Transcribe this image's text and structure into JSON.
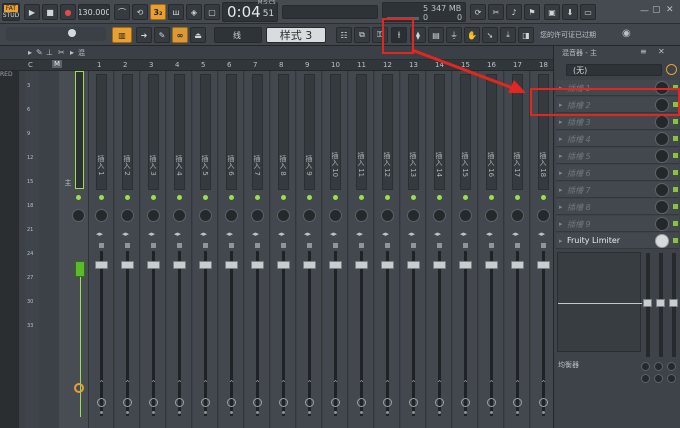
{
  "toolbar": {
    "fl_badge": "FAT",
    "fl_sub": "STUD",
    "tempo": "130.000",
    "time_main": "0:04",
    "time_frac": "51",
    "time_label": "M:S:CS",
    "counter_top": "5",
    "memory": "347 MB",
    "counter_bottom": "0",
    "cpu_top": "0",
    "beat_label": "3₂",
    "pattern_dropdown": "线",
    "pattern_name": "样式 3",
    "hint_text": "您的许可证已过期"
  },
  "mixer": {
    "header_label": "混",
    "ruler": {
      "c_label": "C",
      "m_label": "M"
    },
    "left_label": "RED",
    "master_name": "主",
    "inserts": [
      {
        "num": "1",
        "name": "插入 1"
      },
      {
        "num": "2",
        "name": "插入 2"
      },
      {
        "num": "3",
        "name": "插入 3"
      },
      {
        "num": "4",
        "name": "插入 4"
      },
      {
        "num": "5",
        "name": "插入 5"
      },
      {
        "num": "6",
        "name": "插入 6"
      },
      {
        "num": "7",
        "name": "插入 7"
      },
      {
        "num": "8",
        "name": "插入 8"
      },
      {
        "num": "9",
        "name": "插入 9"
      },
      {
        "num": "10",
        "name": "插入 10"
      },
      {
        "num": "11",
        "name": "插入 11"
      },
      {
        "num": "12",
        "name": "插入 12"
      },
      {
        "num": "13",
        "name": "插入 13"
      },
      {
        "num": "14",
        "name": "插入 14"
      },
      {
        "num": "15",
        "name": "插入 15"
      },
      {
        "num": "16",
        "name": "插入 16"
      },
      {
        "num": "17",
        "name": "插入 17"
      },
      {
        "num": "18",
        "name": "插入 18"
      }
    ],
    "scale": [
      "3",
      "6",
      "9",
      "12",
      "15",
      "18",
      "21",
      "24",
      "27",
      "30",
      "33"
    ]
  },
  "fx_panel": {
    "title": "混音器 - 主",
    "input_dropdown": "(无)",
    "slots": [
      {
        "name": "插槽 1"
      },
      {
        "name": "插槽 2"
      },
      {
        "name": "插槽 3"
      },
      {
        "name": "插槽 4"
      },
      {
        "name": "插槽 5"
      },
      {
        "name": "插槽 6"
      },
      {
        "name": "插槽 7"
      },
      {
        "name": "插槽 8"
      },
      {
        "name": "插槽 9"
      },
      {
        "name": "Fruity Limiter"
      }
    ],
    "eq_label": "均衡器"
  },
  "colors": {
    "accent_red": "#e1271f",
    "led_green": "#9be04a",
    "orange": "#e8a030"
  }
}
